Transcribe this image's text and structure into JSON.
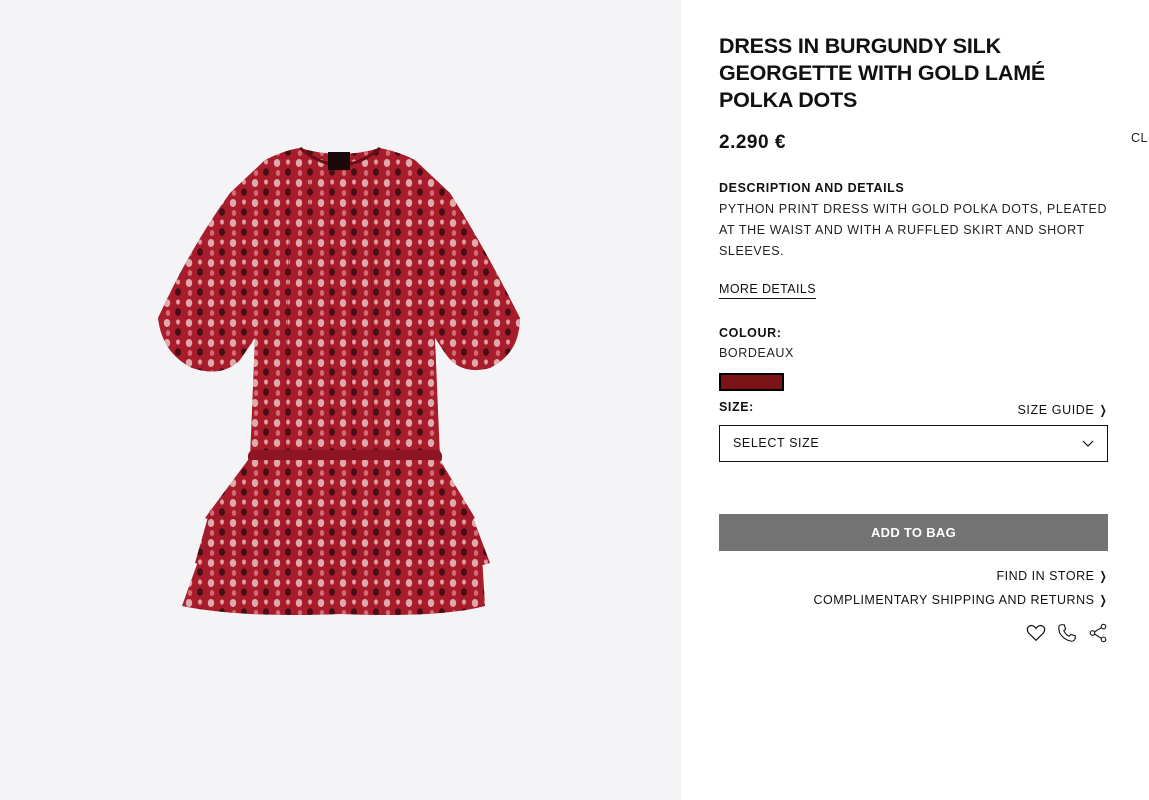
{
  "product": {
    "title": "DRESS IN BURGUNDY SILK GEORGETTE WITH GOLD LAMÉ POLKA DOTS",
    "price": "2.290  €",
    "description_heading": "DESCRIPTION AND DETAILS",
    "description_text": "PYTHON PRINT DRESS WITH GOLD POLKA DOTS, PLEATED AT THE WAIST AND WITH A RUFFLED SKIRT AND SHORT SLEEVES.",
    "more_details": "MORE DETAILS"
  },
  "colour": {
    "label": "COLOUR:",
    "value": "BORDEAUX",
    "swatch_color": "#7a1417"
  },
  "size": {
    "label": "SIZE:",
    "guide_label": "SIZE GUIDE",
    "select_placeholder": "SELECT SIZE"
  },
  "actions": {
    "add_to_bag": "ADD TO BAG",
    "find_in_store": "FIND IN STORE",
    "shipping": "COMPLIMENTARY SHIPPING AND RETURNS"
  },
  "icons": [
    "heart-icon",
    "phone-icon",
    "share-icon"
  ],
  "edge_text": "CL",
  "colors": {
    "image_bg": "#f4f4f6",
    "button_bg": "#737373",
    "dress_primary": "#a81c2c"
  }
}
